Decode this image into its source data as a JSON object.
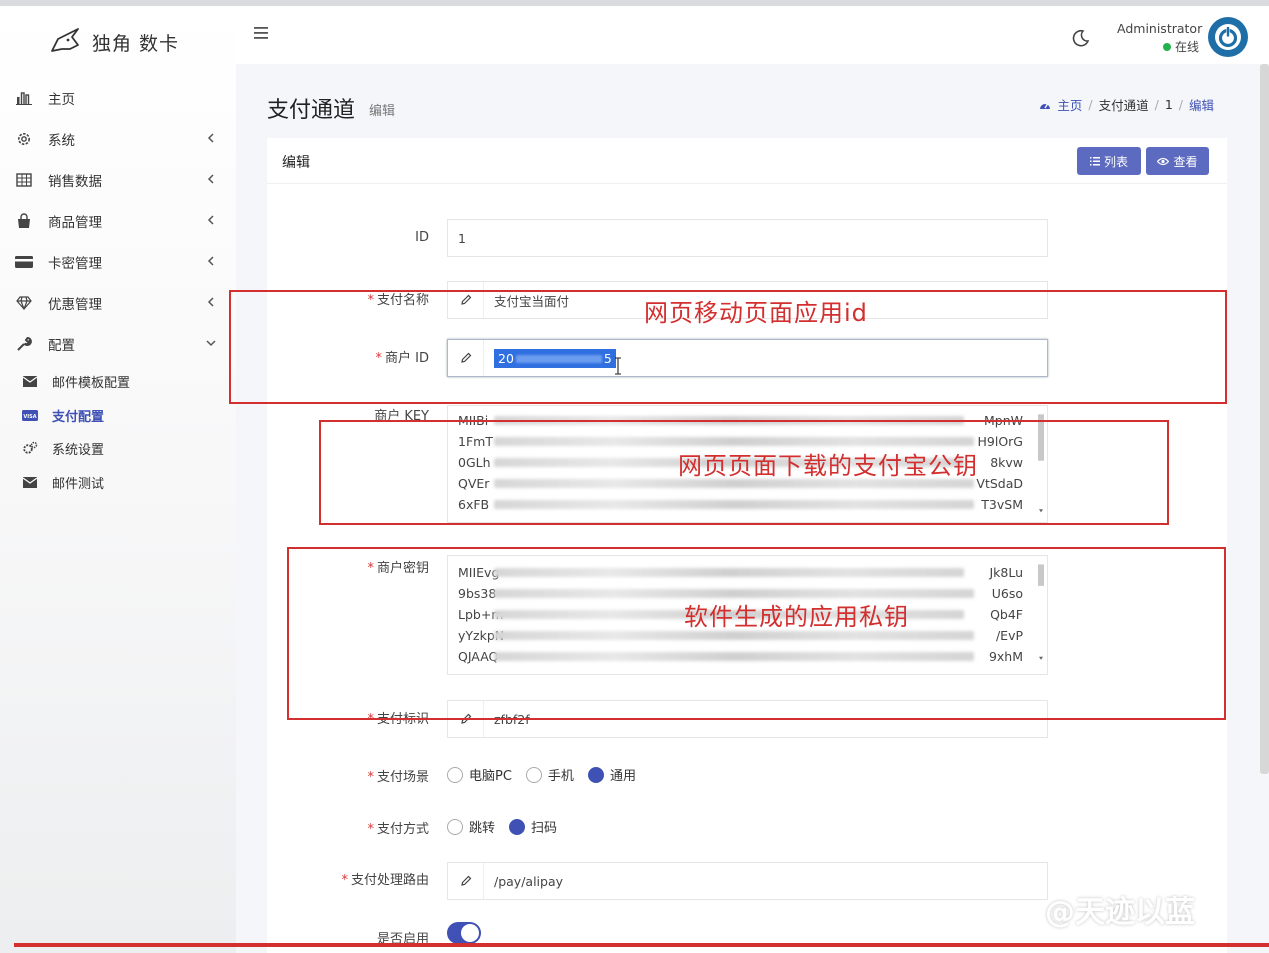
{
  "brand": {
    "name": "独角 数卡"
  },
  "sidebar": {
    "items": [
      {
        "label": "主页",
        "icon": "bar-chart-icon",
        "has_children": false
      },
      {
        "label": "系统",
        "icon": "gear-icon",
        "has_children": true
      },
      {
        "label": "销售数据",
        "icon": "table-icon",
        "has_children": true
      },
      {
        "label": "商品管理",
        "icon": "shopping-bag-icon",
        "has_children": true
      },
      {
        "label": "卡密管理",
        "icon": "credit-card-icon",
        "has_children": true
      },
      {
        "label": "优惠管理",
        "icon": "diamond-icon",
        "has_children": true
      },
      {
        "label": "配置",
        "icon": "wrench-icon",
        "has_children": true,
        "expanded": true
      }
    ],
    "sub_items": [
      {
        "label": "邮件模板配置",
        "icon": "envelope-icon"
      },
      {
        "label": "支付配置",
        "icon": "visa-card-icon",
        "active": true
      },
      {
        "label": "系统设置",
        "icon": "gears-icon"
      },
      {
        "label": "邮件测试",
        "icon": "envelope-icon"
      }
    ]
  },
  "header": {
    "user_name": "Administrator",
    "user_status": "在线",
    "status_color": "#22b14c"
  },
  "page": {
    "title": "支付通道",
    "subtitle": "编辑",
    "breadcrumb": [
      "主页",
      "支付通道",
      "1",
      "编辑"
    ]
  },
  "card": {
    "title": "编辑",
    "list_button": "列表",
    "view_button": "查看"
  },
  "form": {
    "id_label": "ID",
    "id_value": "1",
    "pay_name_label": "支付名称",
    "pay_name_value": "支付宝当面付",
    "merchant_id_label": "商户 ID",
    "merchant_id_value_start": "20",
    "merchant_id_value_end": "5",
    "merchant_key_label": "商户 KEY",
    "merchant_key_lines": [
      {
        "start": "MIIBi",
        "end": "MpnW"
      },
      {
        "start": "1FmT",
        "end": "H9lOrG"
      },
      {
        "start": "0GLh",
        "end": "8kvw"
      },
      {
        "start": "QVEr",
        "end": "VtSdaD"
      },
      {
        "start": "6xFB",
        "end": "T3vSM"
      }
    ],
    "merchant_secret_label": "商户密钥",
    "merchant_secret_lines": [
      {
        "start": "MIIEvg",
        "end": "Jk8Lu"
      },
      {
        "start": "9bs38",
        "end": "U6so"
      },
      {
        "start": "Lpb+m",
        "end": "Qb4F"
      },
      {
        "start": "yYzkpN",
        "end": "/EvP"
      },
      {
        "start": "QJAAQ",
        "end": "9xhM"
      }
    ],
    "pay_check_label": "支付标识",
    "pay_check_value": "zfbf2f",
    "scene_label": "支付场景",
    "scene_options": [
      "电脑PC",
      "手机",
      "通用"
    ],
    "scene_selected": "通用",
    "method_label": "支付方式",
    "method_options": [
      "跳转",
      "扫码"
    ],
    "method_selected": "扫码",
    "route_label": "支付处理路由",
    "route_value": "/pay/alipay",
    "enabled_label": "是否启用",
    "enabled": true
  },
  "annotations": {
    "box1": "网页移动页面应用id",
    "box2": "网页页面下载的支付宝公钥",
    "box3": "软件生成的应用私钥",
    "color": "#d32f2f"
  },
  "watermark": "@天迹以蓝",
  "colors": {
    "primary": "#3f51b5",
    "button": "#5c6bc0",
    "required": "#d93636"
  }
}
